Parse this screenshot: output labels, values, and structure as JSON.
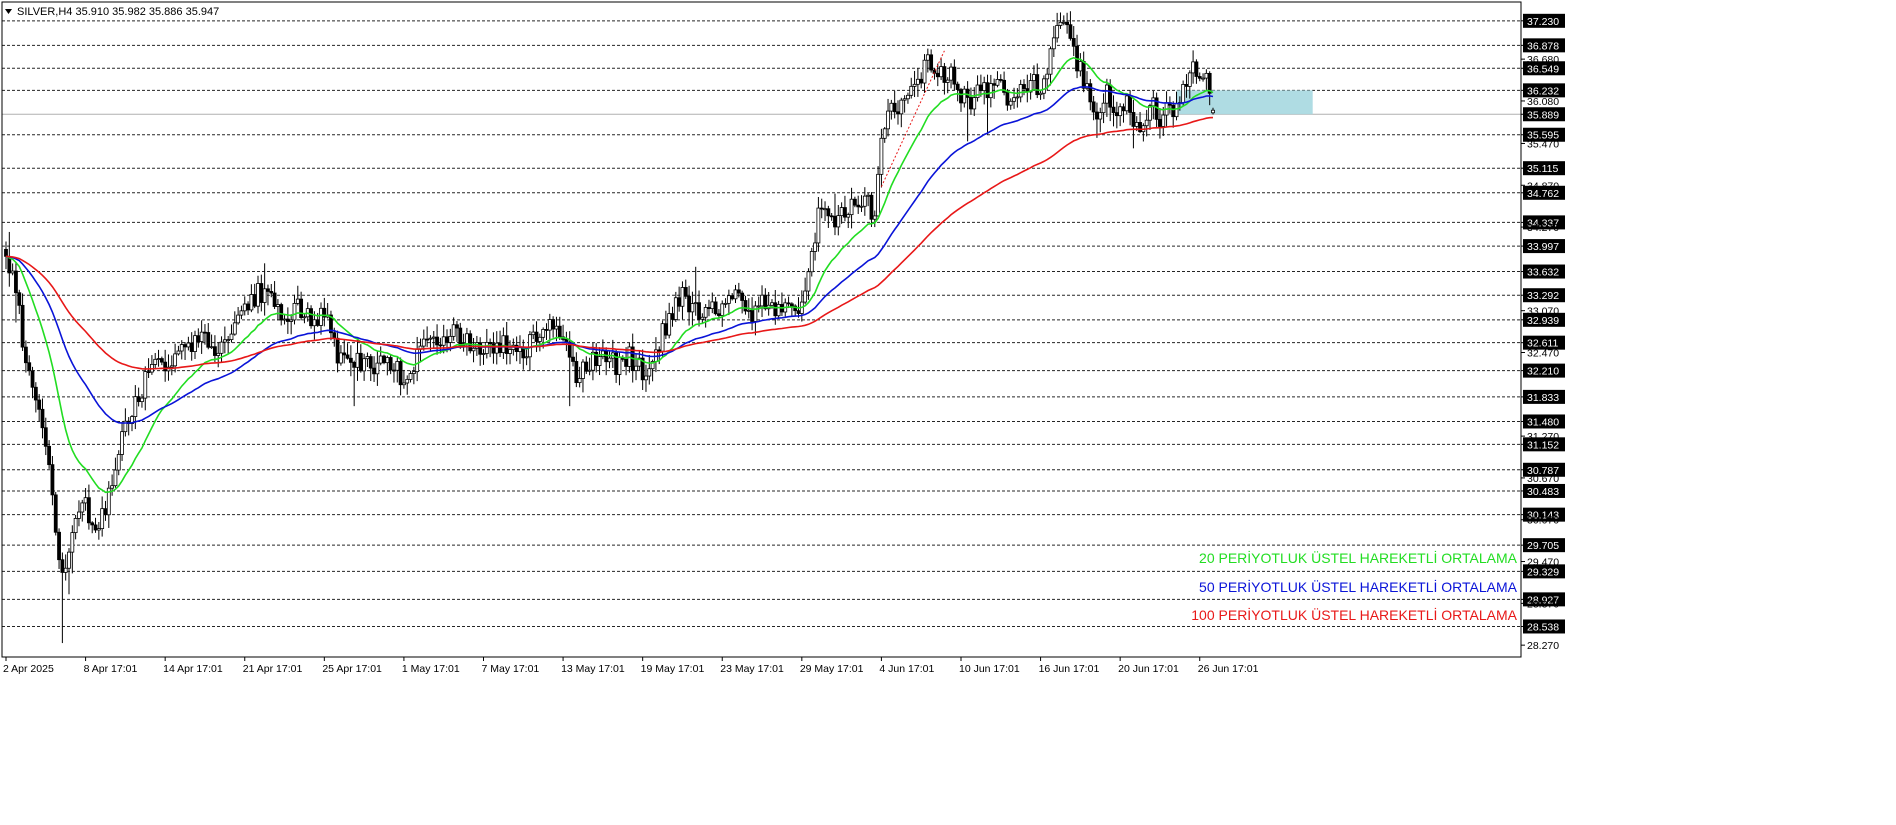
{
  "header": {
    "symbol_info": "SILVER,H4  35.910 35.982 35.886 35.947",
    "arrow_icon": "triangle-down-icon"
  },
  "chart_data": {
    "type": "candlestick",
    "symbol": "SILVER",
    "timeframe": "H4",
    "ohlc_current": {
      "open": 35.91,
      "high": 35.982,
      "low": 35.886,
      "close": 35.947
    },
    "ylim": [
      28.1,
      37.5
    ],
    "xlabel": "",
    "ylabel": "",
    "x_ticks": [
      {
        "i": 0,
        "label": "2 Apr 2025"
      },
      {
        "i": 24,
        "label": "8 Apr 17:01"
      },
      {
        "i": 48,
        "label": "14 Apr 17:01"
      },
      {
        "i": 72,
        "label": "21 Apr 17:01"
      },
      {
        "i": 96,
        "label": "25 Apr 17:01"
      },
      {
        "i": 120,
        "label": "1 May 17:01"
      },
      {
        "i": 144,
        "label": "7 May 17:01"
      },
      {
        "i": 168,
        "label": "13 May 17:01"
      },
      {
        "i": 192,
        "label": "19 May 17:01"
      },
      {
        "i": 216,
        "label": "23 May 17:01"
      },
      {
        "i": 240,
        "label": "29 May 17:01"
      },
      {
        "i": 264,
        "label": "4 Jun 17:01"
      },
      {
        "i": 288,
        "label": "10 Jun 17:01"
      },
      {
        "i": 312,
        "label": "16 Jun 17:01"
      },
      {
        "i": 336,
        "label": "20 Jun 17:01"
      },
      {
        "i": 360,
        "label": "26 Jun 17:01"
      }
    ],
    "y_tick_labels": [
      "37.230",
      "36.878",
      "36.680",
      "36.549",
      "36.232",
      "36.080",
      "35.889",
      "35.595",
      "35.470",
      "35.115",
      "34.870",
      "34.762",
      "34.337",
      "34.270",
      "33.997",
      "33.632",
      "33.292",
      "33.070",
      "32.939",
      "32.611",
      "32.470",
      "32.210",
      "31.833",
      "31.480",
      "31.270",
      "31.152",
      "30.787",
      "30.670",
      "30.483",
      "30.143",
      "30.070",
      "29.705",
      "29.470",
      "29.329",
      "28.927",
      "28.870",
      "28.538",
      "28.270"
    ],
    "levels": [
      37.23,
      36.878,
      36.549,
      36.232,
      35.595,
      35.115,
      34.762,
      34.337,
      33.997,
      33.632,
      33.292,
      32.939,
      32.611,
      32.21,
      31.833,
      31.48,
      31.152,
      30.787,
      30.483,
      30.143,
      29.705,
      29.329,
      28.927,
      28.538
    ],
    "level_labels": [
      "37.230",
      "36.878",
      "36.549",
      "36.232",
      "35.595",
      "35.115",
      "34.762",
      "34.337",
      "33.997",
      "33.632",
      "33.292",
      "32.939",
      "32.611",
      "32.210",
      "31.833",
      "31.480",
      "31.152",
      "30.787",
      "30.483",
      "30.143",
      "29.705",
      "29.329",
      "28.927",
      "28.538"
    ],
    "current_price": 35.889,
    "current_price_label": "35.889",
    "zone": {
      "from_index": 353,
      "to_index": 382,
      "top": 36.232,
      "bottom": 35.889,
      "color": "#a6d8e0"
    },
    "candle_count": 365,
    "close_anchors": [
      [
        0,
        33.85
      ],
      [
        3,
        33.3
      ],
      [
        6,
        32.4
      ],
      [
        10,
        31.6
      ],
      [
        13,
        30.9
      ],
      [
        16,
        29.6
      ],
      [
        18,
        29.3
      ],
      [
        21,
        30.0
      ],
      [
        24,
        30.3
      ],
      [
        27,
        29.9
      ],
      [
        30,
        30.2
      ],
      [
        33,
        30.9
      ],
      [
        36,
        31.4
      ],
      [
        40,
        31.9
      ],
      [
        44,
        32.2
      ],
      [
        48,
        32.35
      ],
      [
        52,
        32.5
      ],
      [
        56,
        32.55
      ],
      [
        60,
        32.7
      ],
      [
        64,
        32.5
      ],
      [
        68,
        32.7
      ],
      [
        72,
        33.1
      ],
      [
        76,
        33.35
      ],
      [
        80,
        33.2
      ],
      [
        84,
        33.0
      ],
      [
        88,
        33.15
      ],
      [
        92,
        32.95
      ],
      [
        96,
        33.0
      ],
      [
        100,
        32.4
      ],
      [
        104,
        32.2
      ],
      [
        108,
        32.4
      ],
      [
        112,
        32.25
      ],
      [
        116,
        32.35
      ],
      [
        120,
        32.1
      ],
      [
        124,
        32.4
      ],
      [
        128,
        32.8
      ],
      [
        132,
        32.65
      ],
      [
        136,
        32.75
      ],
      [
        140,
        32.6
      ],
      [
        144,
        32.45
      ],
      [
        148,
        32.6
      ],
      [
        152,
        32.55
      ],
      [
        156,
        32.45
      ],
      [
        160,
        32.75
      ],
      [
        164,
        32.8
      ],
      [
        168,
        32.6
      ],
      [
        172,
        32.1
      ],
      [
        176,
        32.3
      ],
      [
        180,
        32.45
      ],
      [
        184,
        32.3
      ],
      [
        188,
        32.4
      ],
      [
        192,
        32.2
      ],
      [
        196,
        32.5
      ],
      [
        200,
        32.95
      ],
      [
        204,
        33.3
      ],
      [
        208,
        33.1
      ],
      [
        212,
        33.05
      ],
      [
        216,
        33.1
      ],
      [
        220,
        33.25
      ],
      [
        224,
        33.0
      ],
      [
        228,
        33.15
      ],
      [
        232,
        33.05
      ],
      [
        236,
        33.2
      ],
      [
        240,
        33.05
      ],
      [
        242,
        33.5
      ],
      [
        244,
        34.2
      ],
      [
        246,
        34.6
      ],
      [
        250,
        34.4
      ],
      [
        254,
        34.5
      ],
      [
        258,
        34.65
      ],
      [
        262,
        34.5
      ],
      [
        264,
        35.6
      ],
      [
        266,
        35.9
      ],
      [
        270,
        36.0
      ],
      [
        273,
        36.2
      ],
      [
        276,
        36.4
      ],
      [
        278,
        36.7
      ],
      [
        282,
        36.5
      ],
      [
        286,
        36.4
      ],
      [
        290,
        36.0
      ],
      [
        294,
        36.2
      ],
      [
        298,
        36.35
      ],
      [
        302,
        36.1
      ],
      [
        306,
        36.2
      ],
      [
        310,
        36.3
      ],
      [
        314,
        36.4
      ],
      [
        316,
        37.0
      ],
      [
        318,
        37.2
      ],
      [
        320,
        37.1
      ],
      [
        322,
        36.75
      ],
      [
        324,
        36.5
      ],
      [
        326,
        36.3
      ],
      [
        328,
        36.0
      ],
      [
        330,
        35.9
      ],
      [
        332,
        36.2
      ],
      [
        334,
        35.95
      ],
      [
        336,
        36.1
      ],
      [
        338,
        36.0
      ],
      [
        340,
        35.8
      ],
      [
        342,
        35.7
      ],
      [
        344,
        35.9
      ],
      [
        346,
        36.1
      ],
      [
        348,
        35.8
      ],
      [
        350,
        35.9
      ],
      [
        352,
        36.0
      ],
      [
        354,
        36.1
      ],
      [
        356,
        36.3
      ],
      [
        358,
        36.6
      ],
      [
        360,
        36.5
      ],
      [
        362,
        36.4
      ],
      [
        364,
        35.947
      ]
    ],
    "series": [
      {
        "name": "20 PERİYOTLUK ÜSTEL HAREKETLİ ORTALAMA",
        "period": 20,
        "kind": "EMA",
        "color": "#22dd22"
      },
      {
        "name": "50 PERİYOTLUK ÜSTEL HAREKETLİ ORTALAMA",
        "period": 50,
        "kind": "EMA",
        "color": "#0a14d8"
      },
      {
        "name": "100 PERİYOTLUK ÜSTEL HAREKETLİ ORTALAMA",
        "period": 100,
        "kind": "EMA",
        "color": "#e81818"
      }
    ],
    "legend_position": "bottom-right",
    "grid": false
  }
}
